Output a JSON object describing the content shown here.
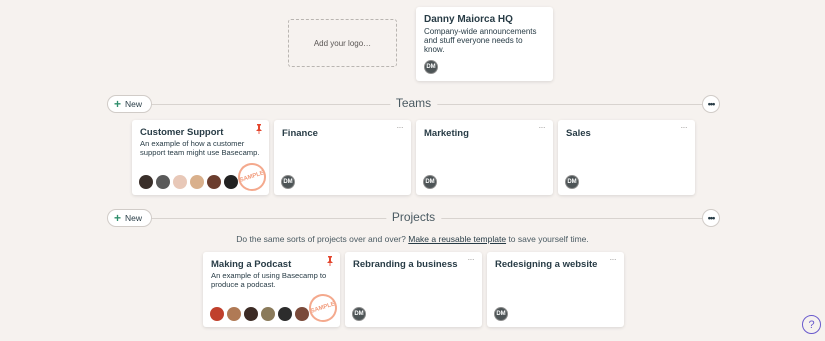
{
  "logo": {
    "placeholder": "Add your logo…"
  },
  "hq": {
    "title": "Danny Maiorca HQ",
    "description": "Company-wide announcements and stuff everyone needs to know.",
    "avatar": "DM"
  },
  "teams": {
    "new_label": "New",
    "title": "Teams",
    "more": "•••",
    "cards": [
      {
        "title": "Customer Support",
        "description": "An example of how a customer support team might use Basecamp.",
        "sample": "SAMPLE"
      },
      {
        "title": "Finance",
        "avatar": "DM",
        "menu": "···"
      },
      {
        "title": "Marketing",
        "avatar": "DM",
        "menu": "···"
      },
      {
        "title": "Sales",
        "avatar": "DM",
        "menu": "···"
      }
    ]
  },
  "projects": {
    "new_label": "New",
    "title": "Projects",
    "more": "•••",
    "hint_before": "Do the same sorts of projects over and over?",
    "hint_link": "Make a reusable template",
    "hint_after": "to save yourself time.",
    "cards": [
      {
        "title": "Making a Podcast",
        "description": "An example of using Basecamp to produce a podcast.",
        "sample": "SAMPLE"
      },
      {
        "title": "Rebranding a business",
        "avatar": "DM",
        "menu": "···"
      },
      {
        "title": "Redesigning a website",
        "avatar": "DM",
        "menu": "···"
      }
    ]
  },
  "help": {
    "label": "?"
  },
  "colors": {
    "background": "#f6f2ef",
    "accent_green": "#2f8f6c",
    "pin_red": "#e3462e",
    "sample_orange": "#f19b7b",
    "help_purple": "#6a5acd"
  }
}
